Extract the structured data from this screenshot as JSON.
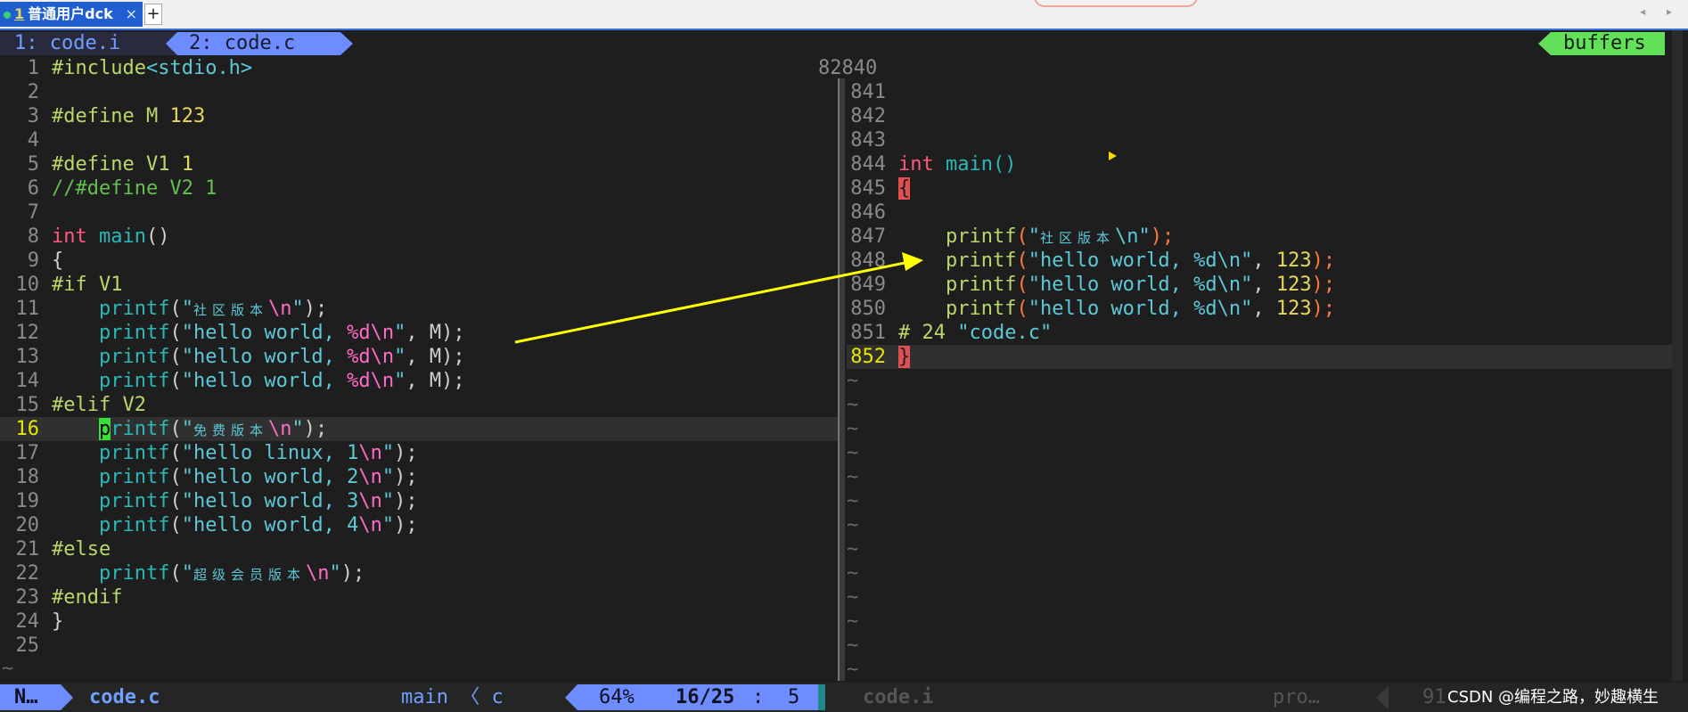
{
  "terminal": {
    "tab_number": "1",
    "tab_title": "普通用户dck",
    "tab_close": "×",
    "add_tab": "+",
    "scroll_arrows": "◂ ▸"
  },
  "vim_tabline": {
    "tab1": "1: code.i",
    "tab2": "2: code.c",
    "buffers": "buffers"
  },
  "left_pane": {
    "lines": [
      {
        "n": "1",
        "segs": [
          {
            "t": "#include",
            "c": "pp"
          },
          {
            "t": "<stdio.h>",
            "c": "str"
          }
        ]
      },
      {
        "n": "2",
        "segs": []
      },
      {
        "n": "3",
        "segs": [
          {
            "t": "#define M ",
            "c": "pp"
          },
          {
            "t": "123",
            "c": "num"
          }
        ]
      },
      {
        "n": "4",
        "segs": []
      },
      {
        "n": "5",
        "segs": [
          {
            "t": "#define V1 ",
            "c": "pp"
          },
          {
            "t": "1",
            "c": "num"
          }
        ]
      },
      {
        "n": "6",
        "segs": [
          {
            "t": "//#define V2 1",
            "c": "cmt"
          }
        ]
      },
      {
        "n": "7",
        "segs": []
      },
      {
        "n": "8",
        "segs": [
          {
            "t": "int",
            "c": "kw"
          },
          {
            "t": " ",
            "c": "par"
          },
          {
            "t": "main",
            "c": "fn"
          },
          {
            "t": "()",
            "c": "par"
          }
        ]
      },
      {
        "n": "9",
        "segs": [
          {
            "t": "{",
            "c": "par"
          }
        ]
      },
      {
        "n": "10",
        "segs": [
          {
            "t": "#if V1",
            "c": "pp"
          }
        ]
      },
      {
        "n": "11",
        "segs": [
          {
            "t": "    ",
            "c": "par"
          },
          {
            "t": "printf",
            "c": "fn"
          },
          {
            "t": "(",
            "c": "par"
          },
          {
            "t": "\"",
            "c": "str"
          },
          {
            "t": "社区版本",
            "c": "cjk"
          },
          {
            "t": "\\n",
            "c": "esc"
          },
          {
            "t": "\"",
            "c": "str"
          },
          {
            "t": ");",
            "c": "par"
          }
        ]
      },
      {
        "n": "12",
        "segs": [
          {
            "t": "    ",
            "c": "par"
          },
          {
            "t": "printf",
            "c": "fn"
          },
          {
            "t": "(",
            "c": "par"
          },
          {
            "t": "\"hello world, ",
            "c": "str"
          },
          {
            "t": "%d\\n",
            "c": "esc"
          },
          {
            "t": "\"",
            "c": "str"
          },
          {
            "t": ", M);",
            "c": "par"
          }
        ]
      },
      {
        "n": "13",
        "segs": [
          {
            "t": "    ",
            "c": "par"
          },
          {
            "t": "printf",
            "c": "fn"
          },
          {
            "t": "(",
            "c": "par"
          },
          {
            "t": "\"hello world, ",
            "c": "str"
          },
          {
            "t": "%d\\n",
            "c": "esc"
          },
          {
            "t": "\"",
            "c": "str"
          },
          {
            "t": ", M);",
            "c": "par"
          }
        ]
      },
      {
        "n": "14",
        "segs": [
          {
            "t": "    ",
            "c": "par"
          },
          {
            "t": "printf",
            "c": "fn"
          },
          {
            "t": "(",
            "c": "par"
          },
          {
            "t": "\"hello world, ",
            "c": "str"
          },
          {
            "t": "%d\\n",
            "c": "esc"
          },
          {
            "t": "\"",
            "c": "str"
          },
          {
            "t": ", M);",
            "c": "par"
          }
        ]
      },
      {
        "n": "15",
        "segs": [
          {
            "t": "#elif V2",
            "c": "pp"
          }
        ]
      },
      {
        "n": "16",
        "cur": true,
        "segs": [
          {
            "t": "    ",
            "c": "par"
          },
          {
            "t": "p",
            "c": "cursor"
          },
          {
            "t": "rintf",
            "c": "fn"
          },
          {
            "t": "(",
            "c": "par"
          },
          {
            "t": "\"",
            "c": "str"
          },
          {
            "t": "免费版本",
            "c": "cjk"
          },
          {
            "t": "\\n",
            "c": "esc"
          },
          {
            "t": "\"",
            "c": "str"
          },
          {
            "t": ");",
            "c": "par"
          }
        ]
      },
      {
        "n": "17",
        "segs": [
          {
            "t": "    ",
            "c": "par"
          },
          {
            "t": "printf",
            "c": "fn"
          },
          {
            "t": "(",
            "c": "par"
          },
          {
            "t": "\"hello linux, 1",
            "c": "str"
          },
          {
            "t": "\\n",
            "c": "esc"
          },
          {
            "t": "\"",
            "c": "str"
          },
          {
            "t": ");",
            "c": "par"
          }
        ]
      },
      {
        "n": "18",
        "segs": [
          {
            "t": "    ",
            "c": "par"
          },
          {
            "t": "printf",
            "c": "fn"
          },
          {
            "t": "(",
            "c": "par"
          },
          {
            "t": "\"hello world, 2",
            "c": "str"
          },
          {
            "t": "\\n",
            "c": "esc"
          },
          {
            "t": "\"",
            "c": "str"
          },
          {
            "t": ");",
            "c": "par"
          }
        ]
      },
      {
        "n": "19",
        "segs": [
          {
            "t": "    ",
            "c": "par"
          },
          {
            "t": "printf",
            "c": "fn"
          },
          {
            "t": "(",
            "c": "par"
          },
          {
            "t": "\"hello world, 3",
            "c": "str"
          },
          {
            "t": "\\n",
            "c": "esc"
          },
          {
            "t": "\"",
            "c": "str"
          },
          {
            "t": ");",
            "c": "par"
          }
        ]
      },
      {
        "n": "20",
        "segs": [
          {
            "t": "    ",
            "c": "par"
          },
          {
            "t": "printf",
            "c": "fn"
          },
          {
            "t": "(",
            "c": "par"
          },
          {
            "t": "\"hello world, 4",
            "c": "str"
          },
          {
            "t": "\\n",
            "c": "esc"
          },
          {
            "t": "\"",
            "c": "str"
          },
          {
            "t": ");",
            "c": "par"
          }
        ]
      },
      {
        "n": "21",
        "segs": [
          {
            "t": "#else",
            "c": "pp"
          }
        ]
      },
      {
        "n": "22",
        "segs": [
          {
            "t": "    ",
            "c": "par"
          },
          {
            "t": "printf",
            "c": "fn"
          },
          {
            "t": "(",
            "c": "par"
          },
          {
            "t": "\"",
            "c": "str"
          },
          {
            "t": "超级会员版本",
            "c": "cjk"
          },
          {
            "t": "\\n",
            "c": "esc"
          },
          {
            "t": "\"",
            "c": "str"
          },
          {
            "t": ");",
            "c": "par"
          }
        ]
      },
      {
        "n": "23",
        "segs": [
          {
            "t": "#endif",
            "c": "pp"
          }
        ]
      },
      {
        "n": "24",
        "segs": [
          {
            "t": "}",
            "c": "par"
          }
        ]
      },
      {
        "n": "25",
        "segs": []
      }
    ],
    "tilde": "~"
  },
  "right_pane": {
    "top_number": "82840",
    "lines": [
      {
        "n": "841",
        "segs": []
      },
      {
        "n": "842",
        "segs": []
      },
      {
        "n": "843",
        "segs": []
      },
      {
        "n": "844",
        "segs": [
          {
            "t": "int",
            "c": "kw"
          },
          {
            "t": " ",
            "c": "par"
          },
          {
            "t": "main",
            "c": "fn"
          },
          {
            "t": "()",
            "c": "fn"
          }
        ]
      },
      {
        "n": "845",
        "segs": [
          {
            "t": "{",
            "c": "brace-red"
          }
        ]
      },
      {
        "n": "846",
        "segs": []
      },
      {
        "n": "847",
        "segs": [
          {
            "t": "    ",
            "c": "par"
          },
          {
            "t": "printf",
            "c": "fnr"
          },
          {
            "t": "(",
            "c": "rpar"
          },
          {
            "t": "\"",
            "c": "str"
          },
          {
            "t": "社区版本",
            "c": "cjk"
          },
          {
            "t": "\\n",
            "c": "str"
          },
          {
            "t": "\"",
            "c": "str"
          },
          {
            "t": ");",
            "c": "rpar"
          }
        ]
      },
      {
        "n": "848",
        "segs": [
          {
            "t": "    ",
            "c": "par"
          },
          {
            "t": "printf",
            "c": "fnr"
          },
          {
            "t": "(",
            "c": "rpar"
          },
          {
            "t": "\"hello world, %d\\n\"",
            "c": "str"
          },
          {
            "t": ", ",
            "c": "par"
          },
          {
            "t": "123",
            "c": "num"
          },
          {
            "t": ");",
            "c": "rpar"
          }
        ]
      },
      {
        "n": "849",
        "segs": [
          {
            "t": "    ",
            "c": "par"
          },
          {
            "t": "printf",
            "c": "fnr"
          },
          {
            "t": "(",
            "c": "rpar"
          },
          {
            "t": "\"hello world, %d\\n\"",
            "c": "str"
          },
          {
            "t": ", ",
            "c": "par"
          },
          {
            "t": "123",
            "c": "num"
          },
          {
            "t": ");",
            "c": "rpar"
          }
        ]
      },
      {
        "n": "850",
        "segs": [
          {
            "t": "    ",
            "c": "par"
          },
          {
            "t": "printf",
            "c": "fnr"
          },
          {
            "t": "(",
            "c": "rpar"
          },
          {
            "t": "\"hello world, %d\\n\"",
            "c": "str"
          },
          {
            "t": ", ",
            "c": "par"
          },
          {
            "t": "123",
            "c": "num"
          },
          {
            "t": ");",
            "c": "rpar"
          }
        ]
      },
      {
        "n": "851",
        "segs": [
          {
            "t": "# 24 ",
            "c": "pp"
          },
          {
            "t": "\"code.c\"",
            "c": "str"
          }
        ]
      },
      {
        "n": "852",
        "cur": true,
        "segs": [
          {
            "t": "}",
            "c": "brace-red"
          }
        ]
      }
    ],
    "tilde": "~",
    "tilde_count": 13
  },
  "statusline": {
    "mode": "N…",
    "filename": "code.c",
    "function": "main 〈 c",
    "percent": "64%",
    "lines": "16/25",
    "col_sep": ":",
    "col": "5",
    "right_filename": "code.i",
    "right_pro": "pro…",
    "right_line": "91"
  },
  "watermark": "CSDN @编程之路，妙趣横生",
  "colors": {
    "tab_active": "#1f5fd0",
    "vim_tab": "#6d8cff",
    "buffers": "#63e05a",
    "annotation_arrow": "#ffff00"
  }
}
